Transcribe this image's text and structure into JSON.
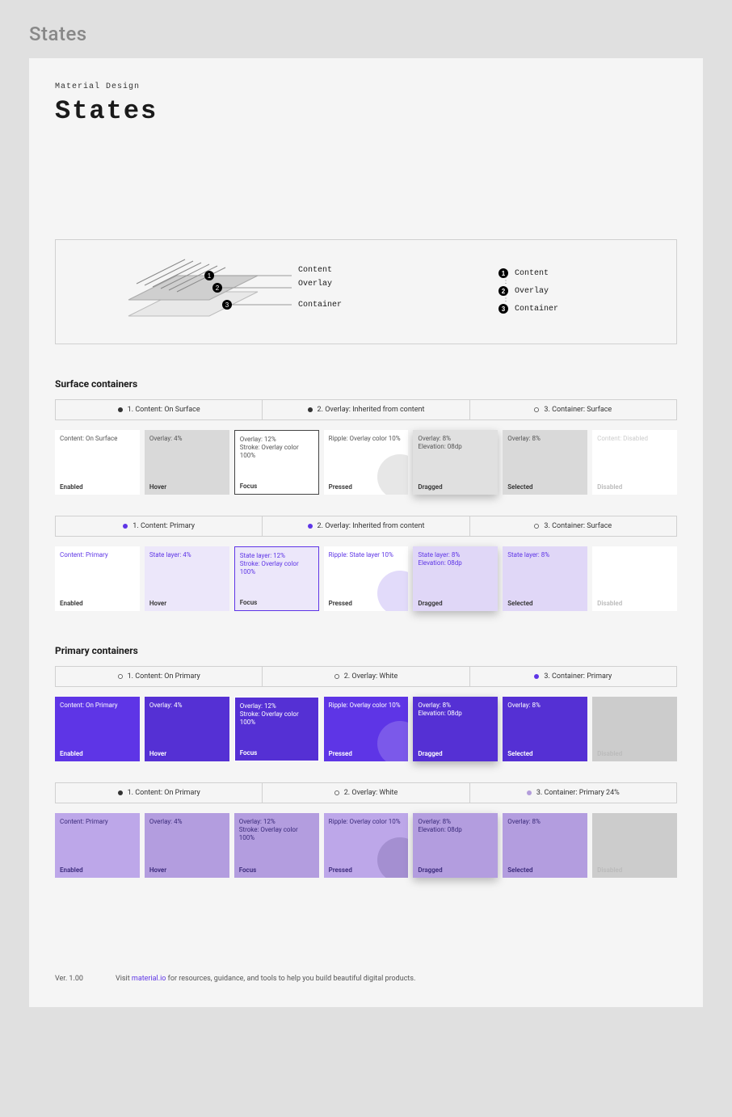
{
  "outer_title": "States",
  "kicker": "Material Design",
  "title": "States",
  "hero": {
    "left_labels": [
      "Content",
      "Overlay",
      "Container"
    ],
    "right_labels": [
      "Content",
      "Overlay",
      "Container"
    ]
  },
  "sections": [
    {
      "heading": "Surface containers",
      "groups": [
        {
          "tabs": [
            {
              "dot": "filled-black",
              "text": "1. Content: On Surface"
            },
            {
              "dot": "filled-black",
              "text": "2. Overlay: Inherited from content"
            },
            {
              "dot": "open-black",
              "text": "3. Container: Surface"
            }
          ],
          "cards": [
            {
              "cls": "bg-white",
              "top": "Content: On Surface",
              "bot": "Enabled",
              "label_cls": ""
            },
            {
              "cls": "bg-gray",
              "top": "Overlay: 4%",
              "bot": "Hover",
              "label_cls": ""
            },
            {
              "cls": "bg-white-out",
              "top": "Overlay: 12%\nStroke: Overlay color 100%",
              "bot": "Focus",
              "label_cls": ""
            },
            {
              "cls": "bg-white ripple",
              "top": "Ripple: Overlay color 10%",
              "bot": "Pressed",
              "label_cls": ""
            },
            {
              "cls": "bg-dragged-gray",
              "top": "Overlay: 8%\nElevation: 08dp",
              "bot": "Dragged",
              "label_cls": ""
            },
            {
              "cls": "bg-gray",
              "top": "Overlay: 8%",
              "bot": "Selected",
              "label_cls": ""
            },
            {
              "cls": "bg-disabled-white",
              "top": "Content: Disabled",
              "bot": "Disabled",
              "label_cls": "off"
            }
          ]
        },
        {
          "tabs": [
            {
              "dot": "filled-primary",
              "text": "1. Content: Primary"
            },
            {
              "dot": "filled-primary",
              "text": "2. Overlay: Inherited from content"
            },
            {
              "dot": "open-black",
              "text": "3. Container: Surface"
            }
          ],
          "cards": [
            {
              "cls": "bg-white txt-primary",
              "top": "Content: Primary",
              "bot": "Enabled",
              "label_cls": ""
            },
            {
              "cls": "bg-lav-lt",
              "top": "State layer: 4%",
              "bot": "Hover",
              "label_cls": ""
            },
            {
              "cls": "bg-lav-out",
              "top": "State layer: 12%\nStroke: Overlay color 100%",
              "bot": "Focus",
              "label_cls": ""
            },
            {
              "cls": "bg-white ripple-primary txt-primary",
              "top": "Ripple: State layer 10%",
              "bot": "Pressed",
              "label_cls": ""
            },
            {
              "cls": "bg-lav-drag",
              "top": "State layer: 8%\nElevation: 08dp",
              "bot": "Dragged",
              "label_cls": ""
            },
            {
              "cls": "bg-lav-md",
              "top": "State layer: 8%",
              "bot": "Selected",
              "label_cls": ""
            },
            {
              "cls": "bg-disabled-white",
              "top": "",
              "bot": "Disabled",
              "label_cls": "off"
            }
          ]
        }
      ]
    },
    {
      "heading": "Primary containers",
      "groups": [
        {
          "tabs": [
            {
              "dot": "open-black",
              "text": "1. Content: On Primary"
            },
            {
              "dot": "open-black",
              "text": "2. Overlay: White"
            },
            {
              "dot": "filled-primary",
              "text": "3. Container: Primary"
            }
          ],
          "cards": [
            {
              "cls": "bg-primary",
              "top": "Content: On Primary",
              "bot": "Enabled",
              "label_cls": "ondark"
            },
            {
              "cls": "bg-primary-d",
              "top": "Overlay: 4%",
              "bot": "Hover",
              "label_cls": "ondark"
            },
            {
              "cls": "bg-primary-out",
              "top": "Overlay: 12%\nStroke: Overlay color 100%",
              "bot": "Focus",
              "label_cls": "ondark"
            },
            {
              "cls": "bg-primary ripple-white",
              "top": "Ripple: Overlay color 10%",
              "bot": "Pressed",
              "label_cls": "ondark"
            },
            {
              "cls": "bg-primary-drag",
              "top": "Overlay: 8%\nElevation: 08dp",
              "bot": "Dragged",
              "label_cls": "ondark"
            },
            {
              "cls": "bg-primary-d",
              "top": "Overlay: 8%",
              "bot": "Selected",
              "label_cls": "ondark"
            },
            {
              "cls": "bg-gray-disabled",
              "top": "",
              "bot": "Disabled",
              "label_cls": "off"
            }
          ]
        },
        {
          "tabs": [
            {
              "dot": "filled-black",
              "text": "1. Content: On Primary"
            },
            {
              "dot": "open-black",
              "text": "2. Overlay: White"
            },
            {
              "dot": "filled-primary-light",
              "text": "3. Container: Primary 24%"
            }
          ],
          "cards": [
            {
              "cls": "bg-soft",
              "top": "Content: Primary",
              "bot": "Enabled",
              "label_cls": "onsoft"
            },
            {
              "cls": "bg-soft-d",
              "top": "Overlay: 4%",
              "bot": "Hover",
              "label_cls": "onsoft"
            },
            {
              "cls": "bg-soft-d",
              "top": "Overlay: 12%\nStroke: Overlay color 100%",
              "bot": "Focus",
              "label_cls": "onsoft"
            },
            {
              "cls": "bg-soft ripple-dark",
              "top": "Ripple: Overlay color 10%",
              "bot": "Pressed",
              "label_cls": "onsoft"
            },
            {
              "cls": "bg-soft-drag",
              "top": "Overlay: 8%\nElevation: 08dp",
              "bot": "Dragged",
              "label_cls": "onsoft"
            },
            {
              "cls": "bg-soft-d",
              "top": "Overlay: 8%",
              "bot": "Selected",
              "label_cls": "onsoft"
            },
            {
              "cls": "bg-gray-disabled",
              "top": "",
              "bot": "Disabled",
              "label_cls": "off"
            }
          ]
        }
      ]
    }
  ],
  "footer": {
    "version": "Ver. 1.00",
    "text_a": "Visit ",
    "link": "material.io",
    "text_b": " for resources, guidance, and tools to help you build beautiful digital products."
  }
}
